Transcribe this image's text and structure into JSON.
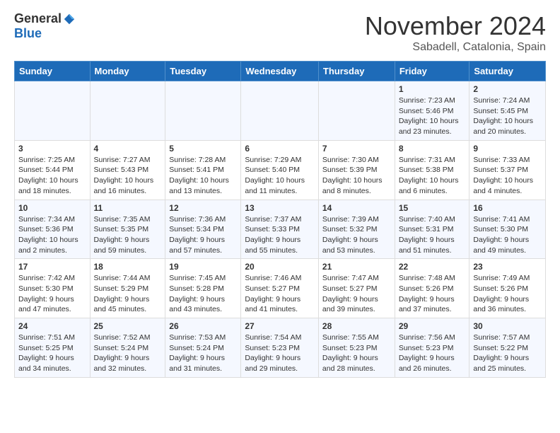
{
  "header": {
    "logo_general": "General",
    "logo_blue": "Blue",
    "month_title": "November 2024",
    "location": "Sabadell, Catalonia, Spain"
  },
  "weekdays": [
    "Sunday",
    "Monday",
    "Tuesday",
    "Wednesday",
    "Thursday",
    "Friday",
    "Saturday"
  ],
  "weeks": [
    [
      {
        "day": "",
        "info": ""
      },
      {
        "day": "",
        "info": ""
      },
      {
        "day": "",
        "info": ""
      },
      {
        "day": "",
        "info": ""
      },
      {
        "day": "",
        "info": ""
      },
      {
        "day": "1",
        "info": "Sunrise: 7:23 AM\nSunset: 5:46 PM\nDaylight: 10 hours and 23 minutes."
      },
      {
        "day": "2",
        "info": "Sunrise: 7:24 AM\nSunset: 5:45 PM\nDaylight: 10 hours and 20 minutes."
      }
    ],
    [
      {
        "day": "3",
        "info": "Sunrise: 7:25 AM\nSunset: 5:44 PM\nDaylight: 10 hours and 18 minutes."
      },
      {
        "day": "4",
        "info": "Sunrise: 7:27 AM\nSunset: 5:43 PM\nDaylight: 10 hours and 16 minutes."
      },
      {
        "day": "5",
        "info": "Sunrise: 7:28 AM\nSunset: 5:41 PM\nDaylight: 10 hours and 13 minutes."
      },
      {
        "day": "6",
        "info": "Sunrise: 7:29 AM\nSunset: 5:40 PM\nDaylight: 10 hours and 11 minutes."
      },
      {
        "day": "7",
        "info": "Sunrise: 7:30 AM\nSunset: 5:39 PM\nDaylight: 10 hours and 8 minutes."
      },
      {
        "day": "8",
        "info": "Sunrise: 7:31 AM\nSunset: 5:38 PM\nDaylight: 10 hours and 6 minutes."
      },
      {
        "day": "9",
        "info": "Sunrise: 7:33 AM\nSunset: 5:37 PM\nDaylight: 10 hours and 4 minutes."
      }
    ],
    [
      {
        "day": "10",
        "info": "Sunrise: 7:34 AM\nSunset: 5:36 PM\nDaylight: 10 hours and 2 minutes."
      },
      {
        "day": "11",
        "info": "Sunrise: 7:35 AM\nSunset: 5:35 PM\nDaylight: 9 hours and 59 minutes."
      },
      {
        "day": "12",
        "info": "Sunrise: 7:36 AM\nSunset: 5:34 PM\nDaylight: 9 hours and 57 minutes."
      },
      {
        "day": "13",
        "info": "Sunrise: 7:37 AM\nSunset: 5:33 PM\nDaylight: 9 hours and 55 minutes."
      },
      {
        "day": "14",
        "info": "Sunrise: 7:39 AM\nSunset: 5:32 PM\nDaylight: 9 hours and 53 minutes."
      },
      {
        "day": "15",
        "info": "Sunrise: 7:40 AM\nSunset: 5:31 PM\nDaylight: 9 hours and 51 minutes."
      },
      {
        "day": "16",
        "info": "Sunrise: 7:41 AM\nSunset: 5:30 PM\nDaylight: 9 hours and 49 minutes."
      }
    ],
    [
      {
        "day": "17",
        "info": "Sunrise: 7:42 AM\nSunset: 5:30 PM\nDaylight: 9 hours and 47 minutes."
      },
      {
        "day": "18",
        "info": "Sunrise: 7:44 AM\nSunset: 5:29 PM\nDaylight: 9 hours and 45 minutes."
      },
      {
        "day": "19",
        "info": "Sunrise: 7:45 AM\nSunset: 5:28 PM\nDaylight: 9 hours and 43 minutes."
      },
      {
        "day": "20",
        "info": "Sunrise: 7:46 AM\nSunset: 5:27 PM\nDaylight: 9 hours and 41 minutes."
      },
      {
        "day": "21",
        "info": "Sunrise: 7:47 AM\nSunset: 5:27 PM\nDaylight: 9 hours and 39 minutes."
      },
      {
        "day": "22",
        "info": "Sunrise: 7:48 AM\nSunset: 5:26 PM\nDaylight: 9 hours and 37 minutes."
      },
      {
        "day": "23",
        "info": "Sunrise: 7:49 AM\nSunset: 5:26 PM\nDaylight: 9 hours and 36 minutes."
      }
    ],
    [
      {
        "day": "24",
        "info": "Sunrise: 7:51 AM\nSunset: 5:25 PM\nDaylight: 9 hours and 34 minutes."
      },
      {
        "day": "25",
        "info": "Sunrise: 7:52 AM\nSunset: 5:24 PM\nDaylight: 9 hours and 32 minutes."
      },
      {
        "day": "26",
        "info": "Sunrise: 7:53 AM\nSunset: 5:24 PM\nDaylight: 9 hours and 31 minutes."
      },
      {
        "day": "27",
        "info": "Sunrise: 7:54 AM\nSunset: 5:23 PM\nDaylight: 9 hours and 29 minutes."
      },
      {
        "day": "28",
        "info": "Sunrise: 7:55 AM\nSunset: 5:23 PM\nDaylight: 9 hours and 28 minutes."
      },
      {
        "day": "29",
        "info": "Sunrise: 7:56 AM\nSunset: 5:23 PM\nDaylight: 9 hours and 26 minutes."
      },
      {
        "day": "30",
        "info": "Sunrise: 7:57 AM\nSunset: 5:22 PM\nDaylight: 9 hours and 25 minutes."
      }
    ]
  ]
}
